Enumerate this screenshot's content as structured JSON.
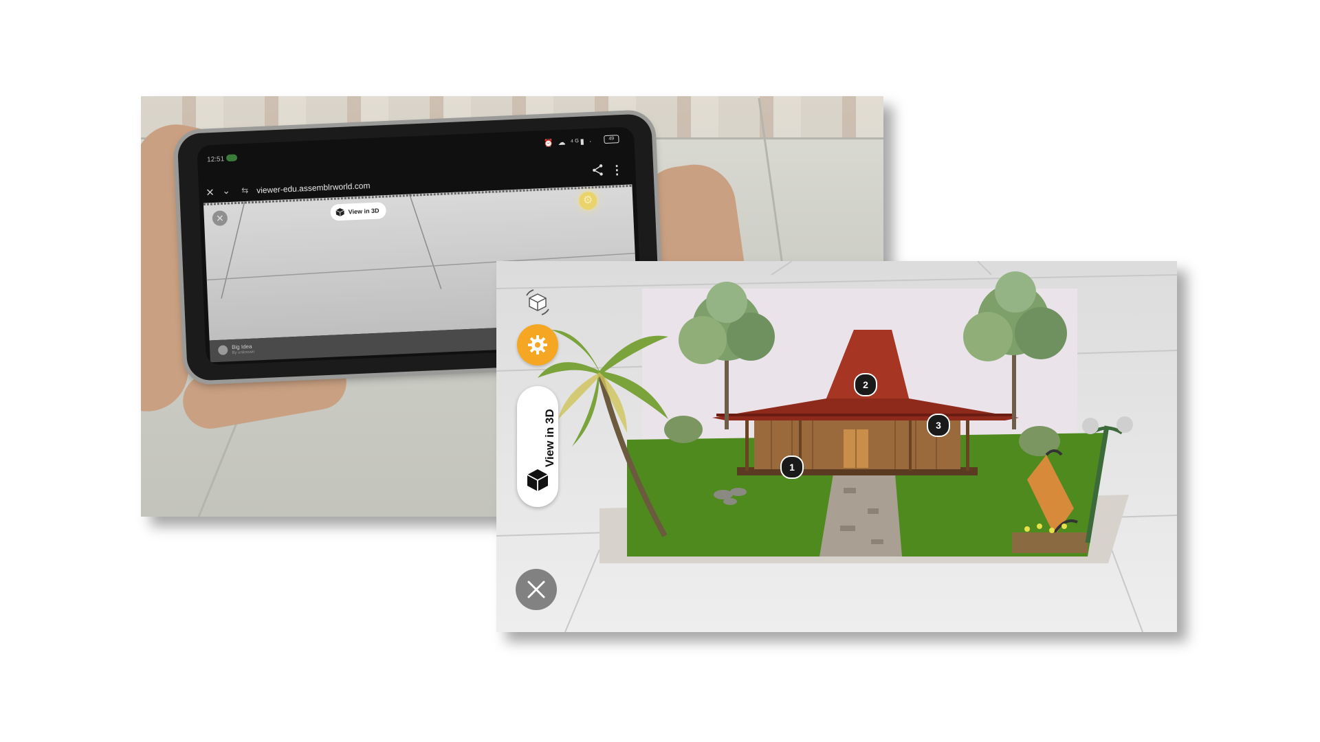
{
  "phone_photo": {
    "status_time": "12:51",
    "status_icons": "⏰ ☁ ⁴ᴳ▮ ·",
    "battery_level": "49",
    "browser": {
      "url": "viewer-edu.assemblrworld.com",
      "close_glyph": "✕",
      "chevron_glyph": "⌄",
      "menu_glyph": "⋮"
    },
    "viewer": {
      "view3d_label": "View in 3D",
      "close_glyph": "✕",
      "gear_glyph": "⚙",
      "footer_title": "Big Idea",
      "footer_author": "By unknown"
    }
  },
  "ar_view": {
    "view3d_label": "View in 3D",
    "hotspots": [
      "1",
      "2",
      "3"
    ],
    "icons": [
      "rotate-3d-icon",
      "gear-icon",
      "cube-icon",
      "close-icon"
    ],
    "colors": {
      "accent": "#f5a623",
      "roof": "#8e2a1c",
      "wall": "#9a6a3c",
      "lawn": "#4e8a1e",
      "path": "#a99f92"
    }
  }
}
